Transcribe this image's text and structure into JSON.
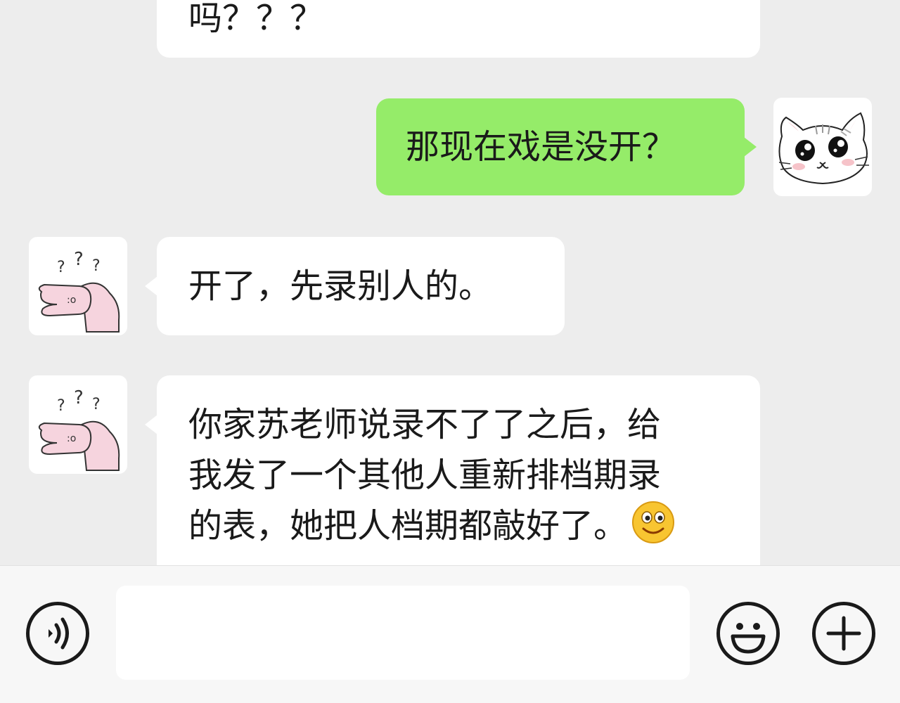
{
  "messages": [
    {
      "sender": "contact",
      "text": "吗？？？"
    },
    {
      "sender": "me",
      "text": "那现在戏是没开？"
    },
    {
      "sender": "contact",
      "text": "开了，先录别人的。"
    },
    {
      "sender": "contact",
      "lines": [
        "你家苏老师说录不了了之后，给",
        "我发了一个其他人重新排档期录",
        "的表，她把人档期都敲好了。"
      ],
      "emoji": "smile-emoji"
    }
  ],
  "avatars": {
    "contact_marks": "? ? ?",
    "contact_face": ":o"
  },
  "input": {
    "value": "",
    "voice_icon": "voice-icon",
    "emoji_icon": "emoji-icon",
    "add_icon": "plus-icon"
  },
  "colors": {
    "background": "#ededed",
    "my_bubble": "#95ec69",
    "contact_bubble": "#ffffff"
  }
}
